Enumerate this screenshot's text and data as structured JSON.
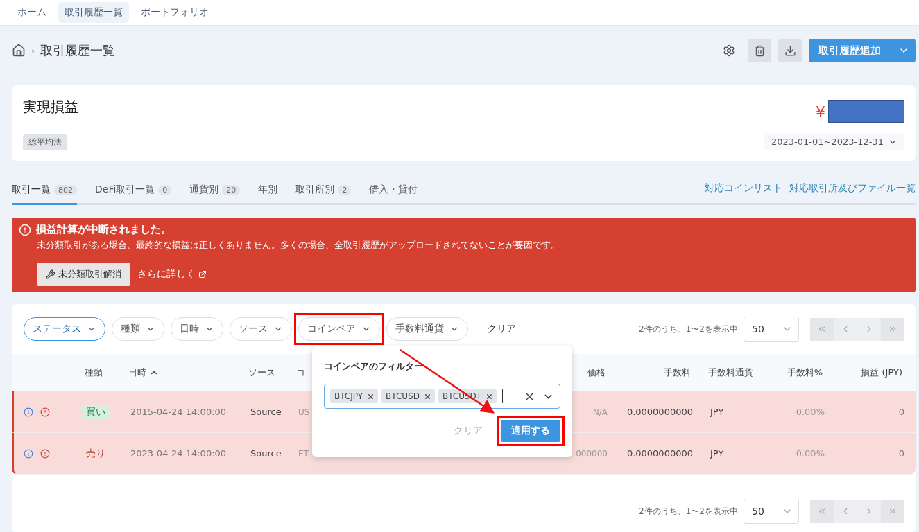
{
  "nav": [
    {
      "label": "ホーム",
      "selected": false
    },
    {
      "label": "取引履歴一覧",
      "selected": true
    },
    {
      "label": "ポートフォリオ",
      "selected": false
    }
  ],
  "breadcrumb": {
    "separator": "›",
    "current": "取引履歴一覧"
  },
  "toolbar": {
    "add_button": "取引履歴追加"
  },
  "summary": {
    "title": "実現損益",
    "method_tag": "総平均法",
    "currency_symbol": "¥",
    "date_range": "2023-01-01~2023-12-31"
  },
  "tabs": [
    {
      "label": "取引一覧",
      "count": "802",
      "selected": true
    },
    {
      "label": "DeFi取引一覧",
      "count": "0",
      "selected": false
    },
    {
      "label": "通貨別",
      "count": "20",
      "selected": false
    },
    {
      "label": "年別",
      "selected": false
    },
    {
      "label": "取引所別",
      "count": "2",
      "selected": false
    },
    {
      "label": "借入・貸付",
      "selected": false
    }
  ],
  "links": [
    "対応コインリスト",
    "対応取引所及びファイル一覧"
  ],
  "alert": {
    "title": "損益計算が中断されました。",
    "message": "未分類取引がある場合、最終的な損益は正しくありません。多くの場合、全取引履歴がアップロードされてないことが要因です。",
    "action": "未分類取引解消",
    "link": "さらに詳しく"
  },
  "filters": [
    {
      "label": "ステータス",
      "active": true,
      "highlighted": false
    },
    {
      "label": "種類",
      "active": false,
      "highlighted": false
    },
    {
      "label": "日時",
      "active": false,
      "highlighted": false
    },
    {
      "label": "ソース",
      "active": false,
      "highlighted": false
    },
    {
      "label": "コインペア",
      "active": false,
      "highlighted": true
    },
    {
      "label": "手数料通貨",
      "active": false,
      "highlighted": false
    }
  ],
  "clear_filters": "クリア",
  "pagination": {
    "summary": "2件のうち、1〜2を表示中",
    "page_size": "50"
  },
  "columns": [
    {
      "label": "種類",
      "sorted": false
    },
    {
      "label": "日時",
      "sorted": true
    },
    {
      "label": "ソース",
      "sorted": false
    },
    {
      "label": "コ",
      "sorted": false
    },
    {
      "label": "価格",
      "sorted": false
    },
    {
      "label": "手数料",
      "sorted": false
    },
    {
      "label": "手数料通貨",
      "sorted": false
    },
    {
      "label": "手数料%",
      "sorted": false
    },
    {
      "label": "損益 (JPY)",
      "sorted": false
    }
  ],
  "rows": [
    {
      "kind": "buy",
      "label": "買い",
      "date": "2015-04-24 14:00:00",
      "source": "Source",
      "coin": "US",
      "price": "N/A",
      "fee": "0.0000000000",
      "fee_currency": "JPY",
      "fee_pct": "0.00%",
      "pnl": "0"
    },
    {
      "kind": "sell",
      "label": "売り",
      "date": "2023-04-24 14:00:00",
      "source": "Source",
      "coin": "ET",
      "price": "000000",
      "fee": "0.0000000000",
      "fee_currency": "JPY",
      "fee_pct": "0.00%",
      "pnl": "0"
    }
  ],
  "popover": {
    "title": "コインペアのフィルター",
    "chips": [
      "BTCJPY",
      "BTCUSD",
      "BTCUSDT"
    ],
    "clear": "クリア",
    "apply": "適用する",
    "apply_highlighted": true
  },
  "bottom_pagination": {
    "summary": "2件のうち、1〜2を表示中",
    "page_size": "50"
  }
}
